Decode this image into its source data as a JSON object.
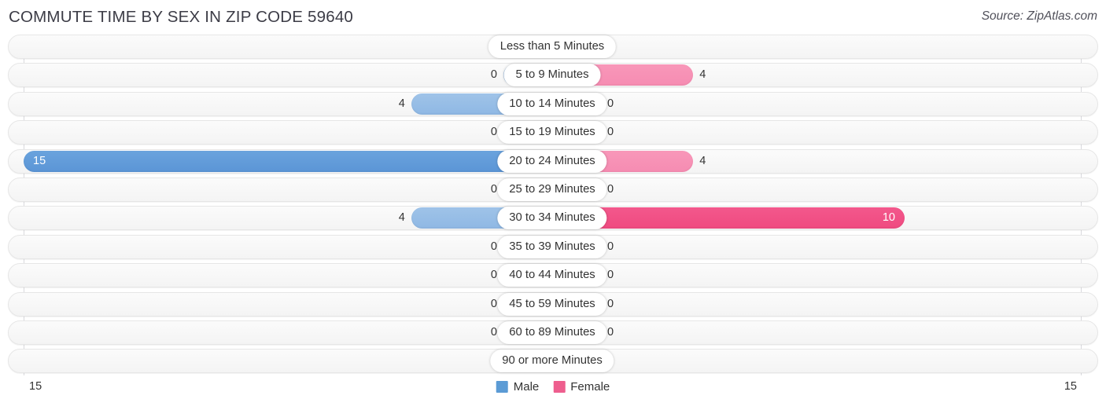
{
  "header": {
    "title": "COMMUTE TIME BY SEX IN ZIP CODE 59640",
    "source": "Source: ZipAtlas.com"
  },
  "legend": {
    "male_label": "Male",
    "female_label": "Female",
    "male_color": "#5b9bd5",
    "female_color": "#ee5e8e"
  },
  "axis": {
    "left_value": "15",
    "right_value": "15",
    "max": 15
  },
  "chart_data": {
    "type": "bar",
    "orientation": "horizontal-diverging",
    "title": "COMMUTE TIME BY SEX IN ZIP CODE 59640",
    "xlabel": "",
    "ylabel": "",
    "xlim": [
      15,
      15
    ],
    "grid": false,
    "legend_position": "bottom-center",
    "categories": [
      "Less than 5 Minutes",
      "5 to 9 Minutes",
      "10 to 14 Minutes",
      "15 to 19 Minutes",
      "20 to 24 Minutes",
      "25 to 29 Minutes",
      "30 to 34 Minutes",
      "35 to 39 Minutes",
      "40 to 44 Minutes",
      "45 to 59 Minutes",
      "60 to 89 Minutes",
      "90 or more Minutes"
    ],
    "series": [
      {
        "name": "Male",
        "color": "#5b9bd5",
        "values": [
          0,
          0,
          4,
          0,
          15,
          0,
          4,
          0,
          0,
          0,
          0,
          0
        ]
      },
      {
        "name": "Female",
        "color": "#ee5e8e",
        "values": [
          0,
          4,
          0,
          0,
          4,
          0,
          10,
          0,
          0,
          0,
          0,
          0
        ]
      }
    ]
  },
  "rows": [
    {
      "label": "Less than 5 Minutes",
      "male": "0",
      "female": "0"
    },
    {
      "label": "5 to 9 Minutes",
      "male": "0",
      "female": "4"
    },
    {
      "label": "10 to 14 Minutes",
      "male": "4",
      "female": "0"
    },
    {
      "label": "15 to 19 Minutes",
      "male": "0",
      "female": "0"
    },
    {
      "label": "20 to 24 Minutes",
      "male": "15",
      "female": "4"
    },
    {
      "label": "25 to 29 Minutes",
      "male": "0",
      "female": "0"
    },
    {
      "label": "30 to 34 Minutes",
      "male": "4",
      "female": "10"
    },
    {
      "label": "35 to 39 Minutes",
      "male": "0",
      "female": "0"
    },
    {
      "label": "40 to 44 Minutes",
      "male": "0",
      "female": "0"
    },
    {
      "label": "45 to 59 Minutes",
      "male": "0",
      "female": "0"
    },
    {
      "label": "60 to 89 Minutes",
      "male": "0",
      "female": "0"
    },
    {
      "label": "90 or more Minutes",
      "male": "0",
      "female": "0"
    }
  ]
}
